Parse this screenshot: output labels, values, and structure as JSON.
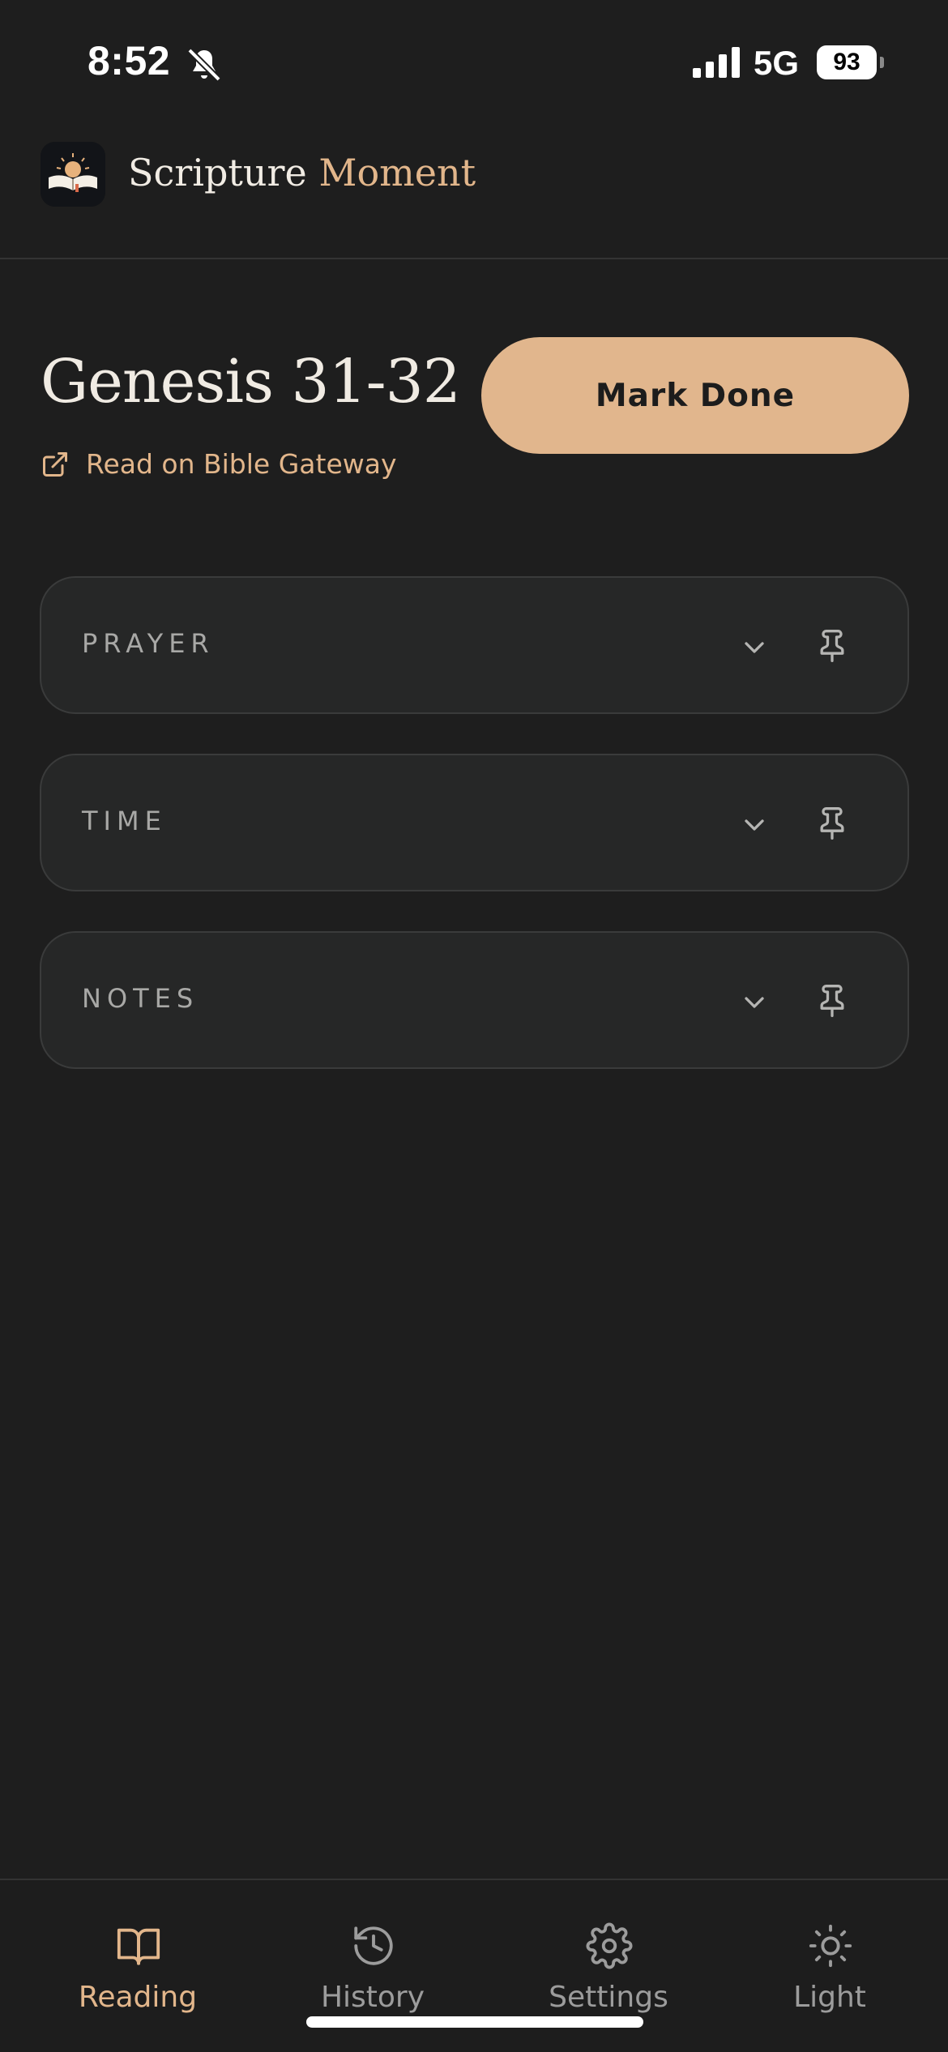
{
  "status_bar": {
    "time": "8:52",
    "network": "5G",
    "battery": "93"
  },
  "app": {
    "title_part1": "Scripture",
    "title_part2": "Moment",
    "accent_color": "#e2b68b"
  },
  "reading": {
    "title": "Genesis 31-32",
    "link_label": "Read on Bible Gateway",
    "mark_done_label": "Mark Done"
  },
  "cards": [
    {
      "label": "PRAYER"
    },
    {
      "label": "TIME"
    },
    {
      "label": "NOTES"
    }
  ],
  "nav": {
    "items": [
      {
        "label": "Reading",
        "icon": "book-icon",
        "active": true
      },
      {
        "label": "History",
        "icon": "history-icon"
      },
      {
        "label": "Settings",
        "icon": "gear-icon"
      },
      {
        "label": "Light",
        "icon": "sun-icon"
      }
    ]
  }
}
